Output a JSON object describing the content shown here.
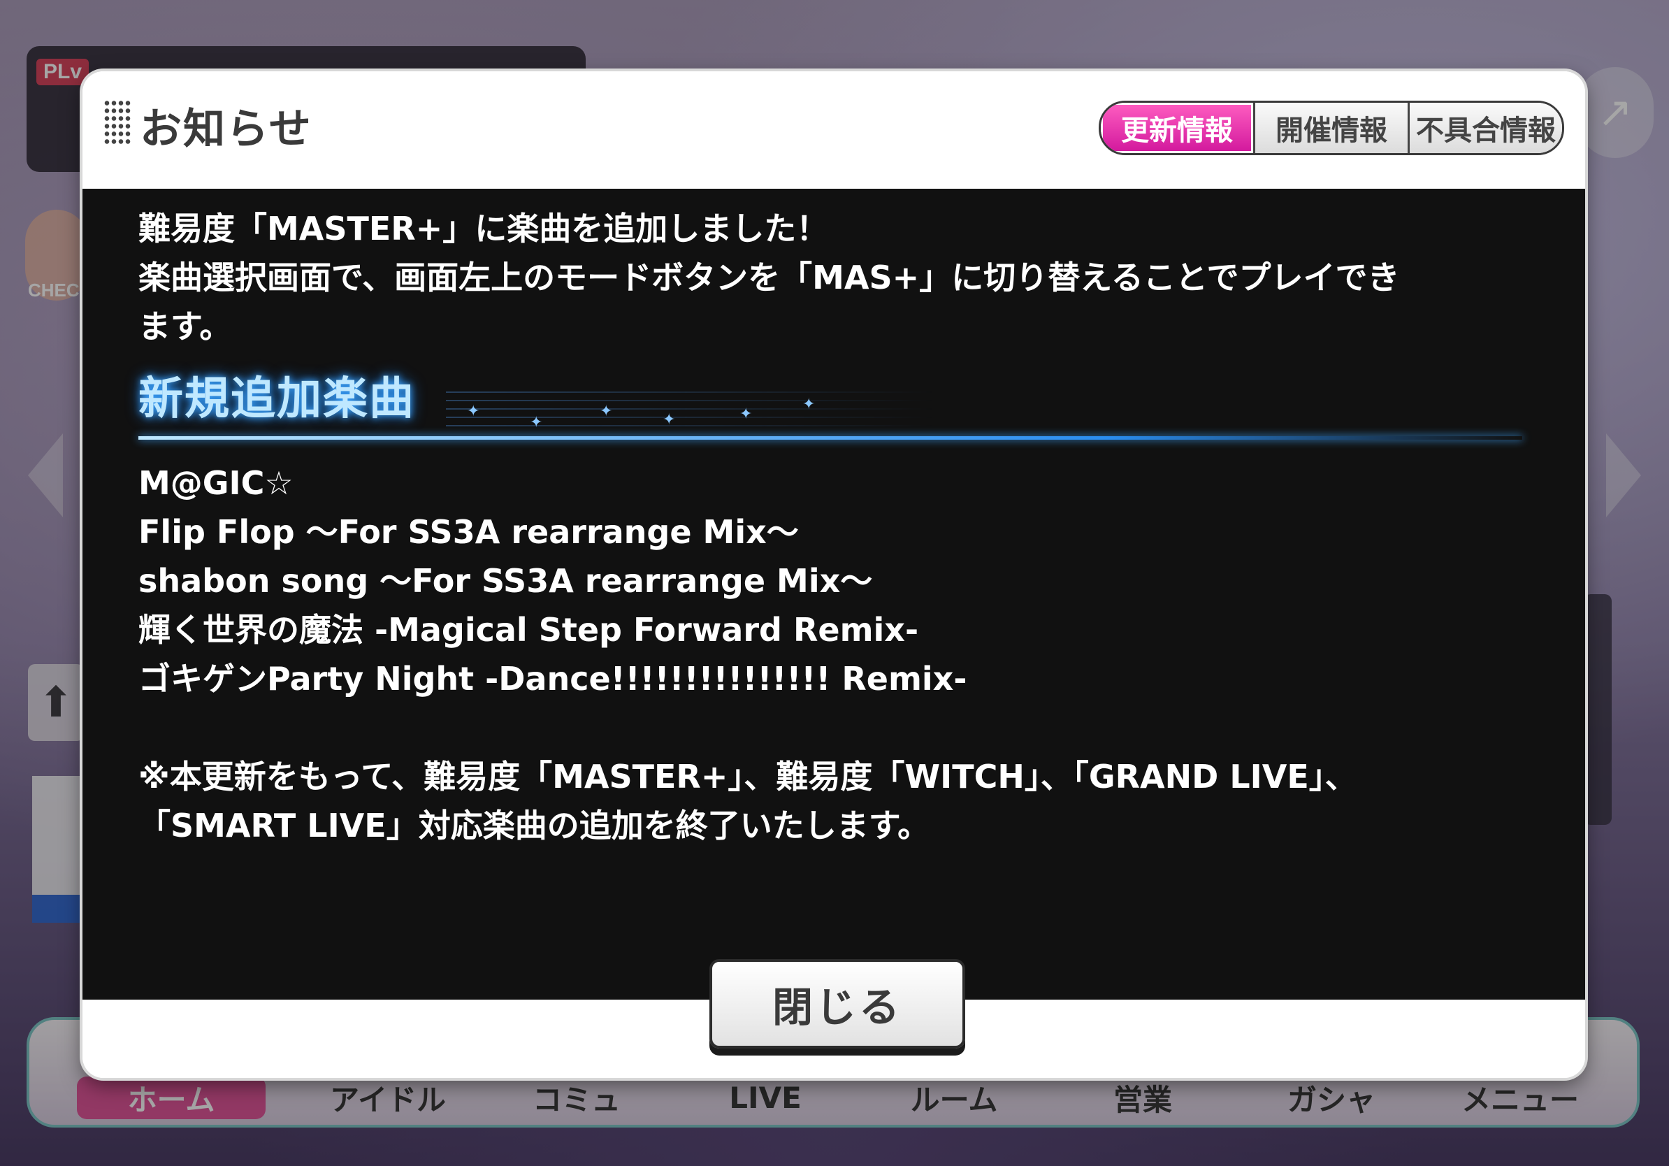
{
  "background": {
    "hud_label": "PLv",
    "check_label": "CHEC",
    "nav": [
      "ホーム",
      "アイドル",
      "コミュ",
      "LIVE",
      "ルーム",
      "営業",
      "ガシャ",
      "メニュー"
    ]
  },
  "modal": {
    "title": "お知らせ",
    "tabs": [
      {
        "label": "更新情報",
        "active": true
      },
      {
        "label": "開催情報",
        "active": false
      },
      {
        "label": "不具合情報",
        "active": false
      }
    ],
    "intro": [
      "難易度「MASTER+」に楽曲を追加しました！",
      "楽曲選択画面で、画面左上のモードボタンを「MAS+」に切り替えることでプレイでき",
      "ます。"
    ],
    "section_title": "新規追加楽曲",
    "songs": [
      "M@GIC☆",
      "Flip Flop 〜For SS3A rearrange Mix〜",
      "shabon song 〜For SS3A rearrange Mix〜",
      "輝く世界の魔法 -Magical Step Forward Remix-",
      "ゴキゲンParty Night -Dance!!!!!!!!!!!!!!! Remix-"
    ],
    "note": [
      "※本更新をもって、難易度「MASTER+」、難易度「WITCH」、「GRAND LIVE」、",
      "「SMART LIVE」対応楽曲の追加を終了いたします。"
    ],
    "close_label": "閉じる"
  },
  "colors": {
    "active_tab": "#e0239f",
    "section_glow": "#3ea6ff",
    "body_bg": "#111111"
  }
}
